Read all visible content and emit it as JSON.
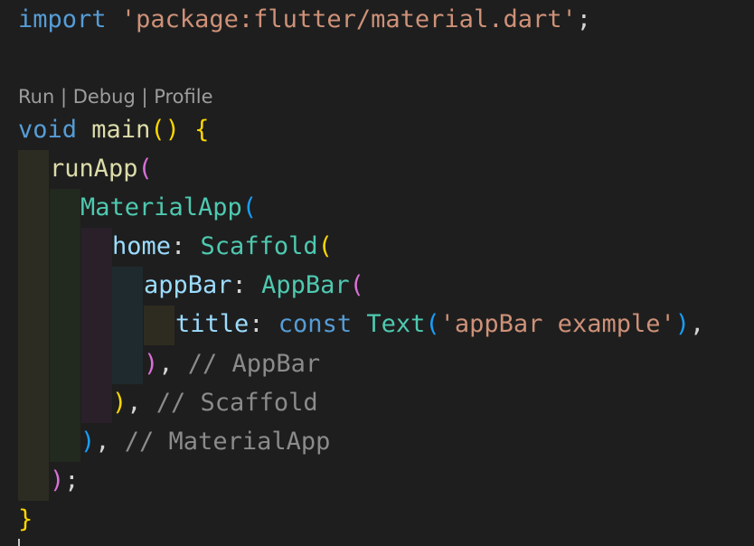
{
  "codelens": {
    "run": "Run",
    "sep": " | ",
    "debug": "Debug",
    "profile": "Profile"
  },
  "lines": {
    "l1": {
      "kw": "import",
      "sp": " ",
      "str": "'package:flutter/material.dart'",
      "end": ";"
    },
    "l4": {
      "kw": "void",
      "sp": " ",
      "fn": "main",
      "paren": "()",
      "sp2": " ",
      "brace": "{"
    },
    "l5": {
      "fn": "runApp",
      "paren": "("
    },
    "l6": {
      "cls": "MaterialApp",
      "paren": "("
    },
    "l7": {
      "prop": "home",
      "colon": ": ",
      "cls": "Scaffold",
      "paren": "("
    },
    "l8": {
      "prop": "appBar",
      "colon": ": ",
      "cls": "AppBar",
      "paren": "("
    },
    "l9": {
      "prop": "title",
      "colon": ": ",
      "kw": "const",
      "sp": " ",
      "cls": "Text",
      "open": "(",
      "str": "'appBar example'",
      "close": ")",
      "end": ","
    },
    "l10": {
      "paren": ")",
      "comma": ", ",
      "comment": "// AppBar"
    },
    "l11": {
      "paren": ")",
      "comma": ", ",
      "comment": "// Scaffold"
    },
    "l12": {
      "paren": ")",
      "comma": ", ",
      "comment": "// MaterialApp"
    },
    "l13": {
      "paren": ")",
      "end": ";"
    },
    "l14": {
      "brace": "}"
    }
  }
}
